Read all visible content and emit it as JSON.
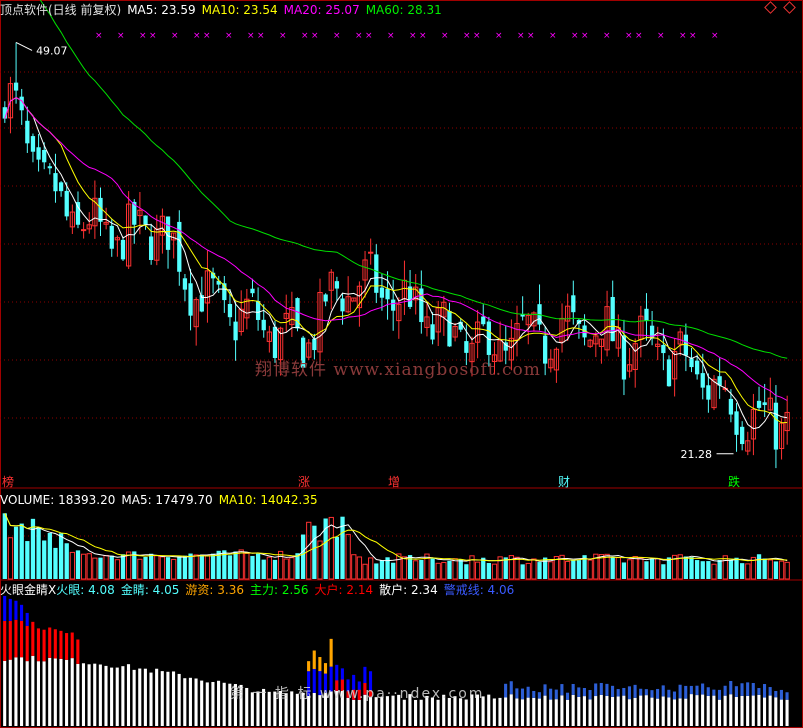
{
  "header": {
    "title": "顶点软件(日线 前复权)",
    "ma5": "MA5: 23.59",
    "ma10": "MA10: 23.54",
    "ma20": "MA20: 25.07",
    "ma60": "MA60: 28.31"
  },
  "price_annotations": {
    "high": "49.07",
    "low": "21.28"
  },
  "signal_labels": [
    "榜",
    "",
    "涨",
    "增",
    "财",
    "跌"
  ],
  "volume_header": {
    "title": "VOLUME: 18393.20",
    "ma5": "MA5: 17479.70",
    "ma10": "MA10: 14042.35"
  },
  "indicator_header": {
    "title": "火眼金睛X",
    "huoyan": "火眼: 4.08",
    "jinjing": "金睛: 4.05",
    "youzi": "游资: 3.36",
    "zhuli": "主力: 2.56",
    "dahu": "大户: 2.14",
    "sanhu": "散户: 2.34",
    "jingjie": "警戒线: 4.06"
  },
  "watermarks": {
    "main": "翔博软件 www.xiangbosoft.com",
    "bottom": "第 一 指 标 www.pa··ndex.com"
  },
  "colors": {
    "up": "#ff3232",
    "down": "#54ffff",
    "ma5": "#ffffff",
    "ma10": "#ffff00",
    "ma20": "#ff00ff",
    "ma60": "#00e000",
    "grid": "#8b0000",
    "jingjie": "#0000ff",
    "youzi": "#ffa500",
    "zhuli": "#00ff00",
    "dahu": "#ff0000"
  },
  "chart_data": [
    {
      "type": "candlestick",
      "title": "顶点软件(日线 前复权)",
      "price_range": [
        19.5,
        51
      ],
      "high_mark": 49.07,
      "low_mark": 21.28,
      "close_path": [
        45.5,
        44,
        42,
        40.5,
        38.6,
        37.8,
        37.2,
        36.6,
        36.2,
        35.9,
        35.6,
        35.7,
        36.1,
        36.7,
        35.9,
        34.6,
        33.4,
        32.2,
        31.4,
        31,
        30.6,
        30.4,
        30.2,
        29.8,
        29.2,
        28.7,
        28.6,
        29.5,
        30.6,
        31.8,
        32.6,
        32.7,
        32.5,
        32.2,
        31.8,
        31.5,
        31,
        30.4,
        29.7,
        29.2,
        28.8,
        28.5,
        28.4,
        28.4,
        28.5,
        28.7,
        28.9,
        29.1,
        29.3,
        29.5,
        29.7,
        29.6,
        29.4,
        29.1,
        28.8,
        28.6,
        28.4,
        28.2,
        28,
        27.6,
        27.1,
        26.6,
        26,
        25.4,
        24.8,
        24.1,
        23.5,
        23.2,
        23.4,
        23.6
      ],
      "legend": [
        "MA5: 23.59",
        "MA10: 23.54",
        "MA20: 25.07",
        "MA60: 28.31"
      ]
    },
    {
      "type": "bar",
      "title": "VOLUME: 18393.20",
      "legend": [
        "MA5: 17479.70",
        "MA10: 14042.35"
      ],
      "ylim": [
        0,
        33000
      ]
    },
    {
      "type": "bar",
      "title": "火眼金睛X",
      "legend": [
        "火眼: 4.08",
        "金睛: 4.05",
        "游资: 3.36",
        "主力: 2.56",
        "大户: 2.14",
        "散户: 2.34",
        "警戒线: 4.06"
      ]
    }
  ]
}
